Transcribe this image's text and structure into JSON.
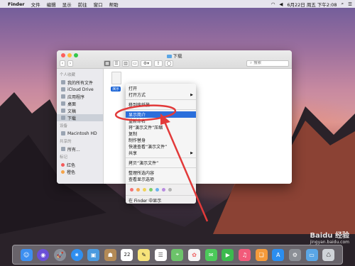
{
  "menubar": {
    "app": "Finder",
    "items": [
      "文件",
      "编辑",
      "显示",
      "前往",
      "窗口",
      "帮助"
    ],
    "clock": "6月22日 周五 下午2:08"
  },
  "window": {
    "title": "下载",
    "search_placeholder": "搜索"
  },
  "sidebar": {
    "sections": [
      {
        "header": "个人收藏",
        "items": [
          "我的所有文件",
          "iCloud Drive",
          "应用程序",
          "桌面",
          "文稿",
          "下载"
        ]
      },
      {
        "header": "设备",
        "items": [
          "Macintosh HD"
        ]
      },
      {
        "header": "共享的",
        "items": [
          "所有..."
        ]
      },
      {
        "header": "标记",
        "items": [
          "红色",
          "橙色"
        ]
      }
    ],
    "selected": "下载"
  },
  "file": {
    "label": "演示"
  },
  "context_menu": {
    "items": [
      {
        "label": "打开",
        "submenu": false
      },
      {
        "label": "打开方式",
        "submenu": true
      },
      {
        "sep": true
      },
      {
        "label": "移到废纸篓",
        "submenu": false
      },
      {
        "sep": true
      },
      {
        "label": "显示简介",
        "submenu": false,
        "highlight": true
      },
      {
        "label": "重新命名",
        "submenu": false
      },
      {
        "label": "将“演示文件”压缩",
        "submenu": false
      },
      {
        "label": "复制",
        "submenu": false
      },
      {
        "label": "制作替身",
        "submenu": false
      },
      {
        "label": "快速查看“演示文件”",
        "submenu": false
      },
      {
        "label": "共享",
        "submenu": true
      },
      {
        "sep": true
      },
      {
        "label": "拷贝“演示文件”",
        "submenu": false
      },
      {
        "sep": true
      },
      {
        "label": "整理所选内容",
        "submenu": false
      },
      {
        "label": "查看显示选项",
        "submenu": false
      },
      {
        "sep": true
      },
      {
        "tags": true
      },
      {
        "sep": true
      },
      {
        "label": "在 Finder 中显示",
        "submenu": false
      }
    ],
    "tag_colors": [
      "#f47373",
      "#f5a855",
      "#f0d35a",
      "#7ccf6d",
      "#6ab2ee",
      "#b88be0",
      "#b3b3b3"
    ]
  },
  "watermark": {
    "text": "Baidu 经验",
    "url": "jingyan.baidu.com"
  },
  "dock": {
    "icons": [
      "finder-icon",
      "siri-icon",
      "launchpad-icon",
      "safari-icon",
      "photos-app-icon",
      "contacts-icon",
      "calendar-icon",
      "notes-icon",
      "reminders-icon",
      "maps-icon",
      "photos-icon",
      "messages-icon",
      "facetime-icon",
      "music-icon",
      "books-icon",
      "appstore-icon",
      "settings-icon",
      "folder-icon",
      "trash-icon"
    ],
    "calendar_day": "22"
  },
  "colors": {
    "highlight": "#2a6edb",
    "annotation": "#e23a3a"
  }
}
